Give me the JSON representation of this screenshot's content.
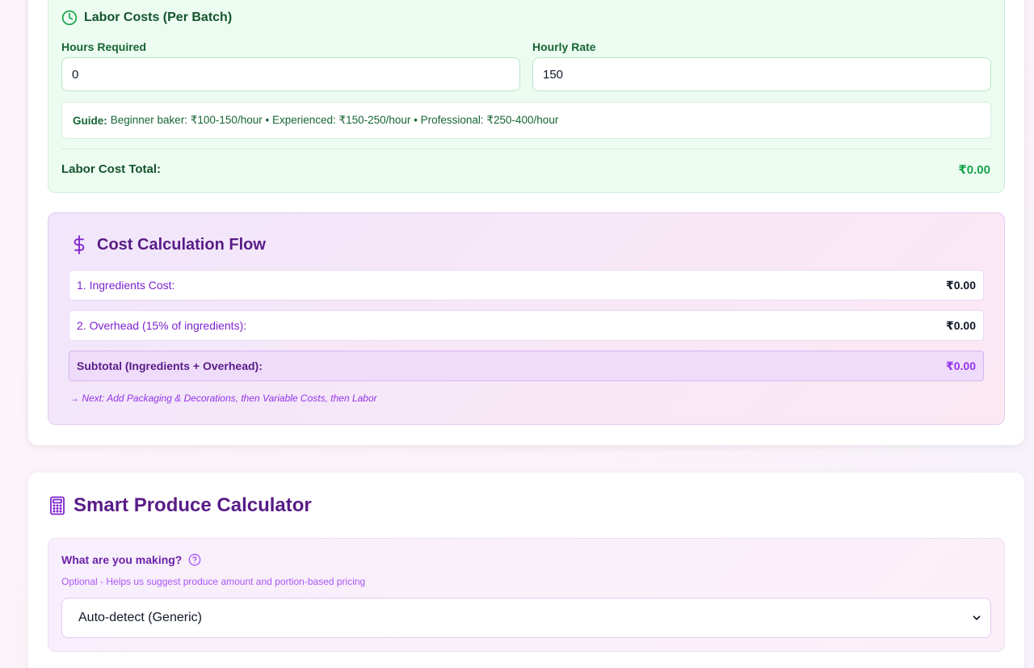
{
  "labor": {
    "title": "Labor Costs (Per Batch)",
    "hours_label": "Hours Required",
    "hours_value": "0",
    "rate_label": "Hourly Rate",
    "rate_value": "150",
    "guide_prefix": "Guide:",
    "guide_text": "Beginner baker: ₹100-150/hour • Experienced: ₹150-250/hour • Professional: ₹250-400/hour",
    "total_label": "Labor Cost Total:",
    "total_value": "₹0.00"
  },
  "flow": {
    "title": "Cost Calculation Flow",
    "rows": [
      {
        "label": "1. Ingredients Cost:",
        "value": "₹0.00"
      },
      {
        "label": "2. Overhead (15% of ingredients):",
        "value": "₹0.00"
      },
      {
        "label": "Subtotal (Ingredients + Overhead):",
        "value": "₹0.00"
      }
    ],
    "note": "→ Next: Add Packaging & Decorations, then Variable Costs, then Labor"
  },
  "smart": {
    "title": "Smart Produce Calculator",
    "making_label": "What are you making?",
    "making_hint": "Optional - Helps us suggest produce amount and portion-based pricing",
    "selected_option": "Auto-detect (Generic)"
  },
  "colors": {
    "labor_accent": "#16a34a",
    "flow_accent": "#9333ea",
    "title_purple": "#581c87"
  }
}
